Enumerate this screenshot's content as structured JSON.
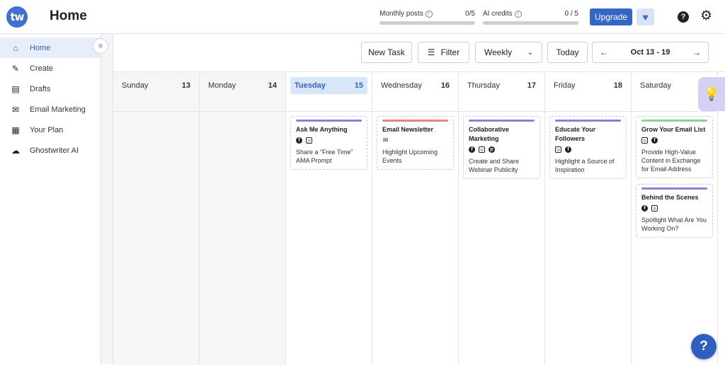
{
  "header": {
    "logo": "tw",
    "title": "Home",
    "monthly_posts": {
      "label": "Monthly posts",
      "count": "0/5",
      "progress": 0
    },
    "ai_credits": {
      "label": "AI credits",
      "count": "0 / 5",
      "progress": 0
    },
    "upgrade_label": "Upgrade",
    "heart_icon": "heart-icon",
    "help_icon": "question-icon",
    "settings_icon": "gear-icon"
  },
  "sidebar": {
    "items": [
      {
        "label": "Home",
        "icon": "home-icon",
        "glyph": "⌂",
        "active": true
      },
      {
        "label": "Create",
        "icon": "brush-icon",
        "glyph": "✎",
        "active": false
      },
      {
        "label": "Drafts",
        "icon": "drafts-icon",
        "glyph": "▤",
        "active": false
      },
      {
        "label": "Email Marketing",
        "icon": "email-icon",
        "glyph": "✉",
        "active": false
      },
      {
        "label": "Your Plan",
        "icon": "calendar-icon",
        "glyph": "▦",
        "active": false
      },
      {
        "label": "Ghostwriter AI",
        "icon": "ghost-icon",
        "glyph": "☁",
        "active": false
      }
    ]
  },
  "toolbar": {
    "new_task_label": "New Task",
    "filter_label": "Filter",
    "view_select": "Weekly",
    "today_label": "Today",
    "range_label": "Oct 13 - 19"
  },
  "days": [
    {
      "name": "Sunday",
      "num": "13",
      "today": false
    },
    {
      "name": "Monday",
      "num": "14",
      "today": false
    },
    {
      "name": "Tuesday",
      "num": "15",
      "today": true
    },
    {
      "name": "Wednesday",
      "num": "16",
      "today": false
    },
    {
      "name": "Thursday",
      "num": "17",
      "today": false
    },
    {
      "name": "Friday",
      "num": "18",
      "today": false
    },
    {
      "name": "Saturday",
      "num": "",
      "today": false
    }
  ],
  "tasks": [
    {
      "day": 2,
      "title": "Ask Me Anything",
      "icons": [
        "fb",
        "ig"
      ],
      "desc": "Share a “Free Time” AMA Prompt",
      "color": "#8c7fe0"
    },
    {
      "day": 3,
      "title": "Email Newsletter",
      "icons": [
        "mail"
      ],
      "desc": "Highlight Upcoming Events",
      "color": "#e8847c"
    },
    {
      "day": 4,
      "title": "Collaborative Marketing",
      "icons": [
        "fb",
        "ig",
        "pin"
      ],
      "desc": "Create and Share Webinar Publicity",
      "color": "#8c7fe0"
    },
    {
      "day": 5,
      "title": "Educate Your Followers",
      "icons": [
        "ig",
        "fb"
      ],
      "desc": "Highlight a Source of Inspiration",
      "color": "#8c7fe0"
    },
    {
      "day": 6,
      "title": "Grow Your Email List",
      "icons": [
        "ig",
        "fb"
      ],
      "desc": "Provide High-Value Content in Exchange for Email Address",
      "color": "#8fd19a"
    },
    {
      "day": 6,
      "title": "Behind the Scenes",
      "icons": [
        "fb",
        "ig"
      ],
      "desc": "Spotlight What Are You Working On?",
      "color": "#8c7fe0"
    }
  ],
  "fab_label": "?"
}
